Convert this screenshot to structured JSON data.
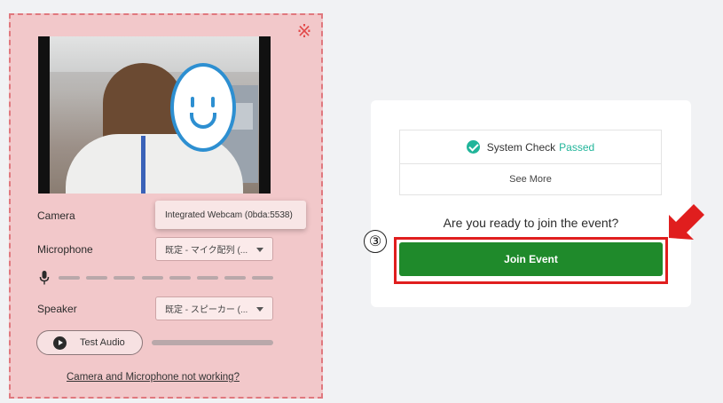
{
  "annotation": {
    "mark": "※",
    "step_number": "③",
    "highlight_color": "#e01e1e"
  },
  "settings_panel": {
    "camera": {
      "label": "Camera",
      "selected": "Integrated Webcam (0bda:5538)"
    },
    "microphone": {
      "label": "Microphone",
      "selected": "既定 - マイク配列 (..."
    },
    "speaker": {
      "label": "Speaker",
      "selected": "既定 - スピーカー (..."
    },
    "test_audio_label": "Test Audio",
    "help_link": "Camera and Microphone not working?",
    "icons": [
      "microphone-icon",
      "play-icon",
      "dropdown-caret-icon"
    ]
  },
  "event_card": {
    "system_check": {
      "label": "System Check",
      "status": "Passed",
      "status_color": "#21b59a"
    },
    "see_more": "See More",
    "question": "Are you ready to join the event?",
    "join_button": "Join Event",
    "join_color": "#1f8a2b"
  }
}
